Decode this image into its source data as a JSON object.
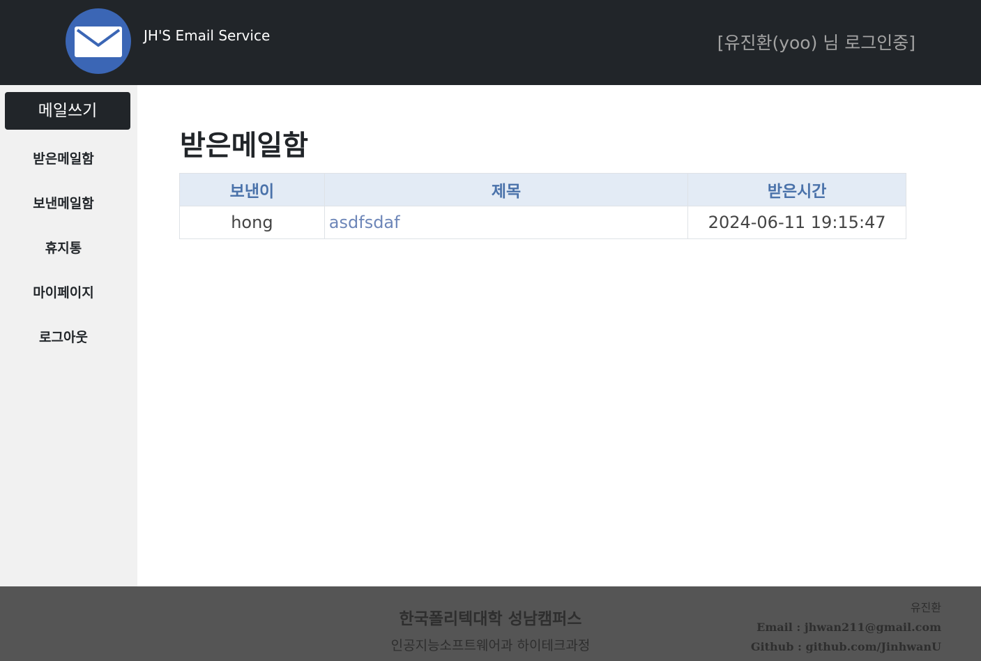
{
  "header": {
    "site_title": "JH'S Email Service",
    "login_status": "[유진환(yoo) 님 로그인중]",
    "logo_icon": "envelope-icon"
  },
  "sidebar": {
    "compose_label": "메일쓰기",
    "items": [
      {
        "label": "받은메일함"
      },
      {
        "label": "보낸메일함"
      },
      {
        "label": "휴지통"
      },
      {
        "label": "마이페이지"
      },
      {
        "label": "로그아웃"
      }
    ]
  },
  "main": {
    "page_title": "받은메일함",
    "table": {
      "columns": [
        "보낸이",
        "제목",
        "받은시간"
      ],
      "rows": [
        {
          "sender": "hong",
          "subject": "asdfsdaf",
          "received": "2024-06-11 19:15:47"
        }
      ]
    }
  },
  "footer": {
    "school": "한국폴리텍대학 성남캠퍼스",
    "department": "인공지능소프트웨어과 하이테크과정",
    "author": "유진환",
    "email": "Email : jhwan211@gmail.com",
    "github": "Github : github.com/JinhwanU"
  },
  "colors": {
    "header_bg": "#212529",
    "logo_bg": "#3b66b5",
    "sidebar_bg": "#f1f1f1",
    "table_header_bg": "#e3ebf5",
    "table_header_text": "#4a72aa",
    "link": "#6d86b8",
    "footer_bg": "#555555"
  }
}
